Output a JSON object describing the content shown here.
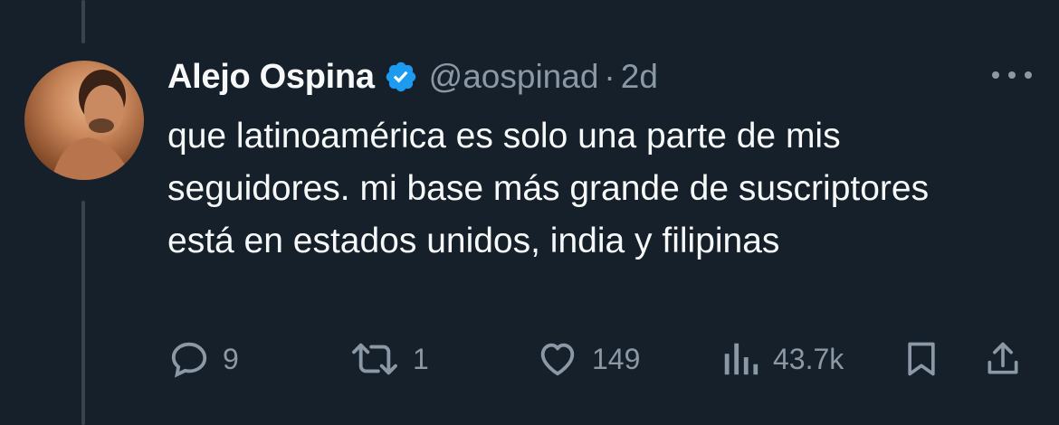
{
  "tweet": {
    "author_name": "Alejo Ospina",
    "handle": "@aospinad",
    "separator": "·",
    "time": "2d",
    "text": "que latinoamérica es solo una parte de mis seguidores. mi base más grande de suscriptores está en estados unidos, india y filipinas"
  },
  "actions": {
    "replies": "9",
    "retweets": "1",
    "likes": "149",
    "views": "43.7k"
  },
  "icons": {
    "verified": "verified-badge-icon",
    "more": "more-dots-icon",
    "reply": "reply-icon",
    "retweet": "retweet-icon",
    "like": "heart-icon",
    "views": "views-icon",
    "bookmark": "bookmark-icon",
    "share": "share-icon"
  },
  "colors": {
    "background": "#15202b",
    "text": "#f7f9f9",
    "muted": "#8b98a5",
    "verified": "#1d9bf0",
    "thread_line": "#38444d"
  }
}
